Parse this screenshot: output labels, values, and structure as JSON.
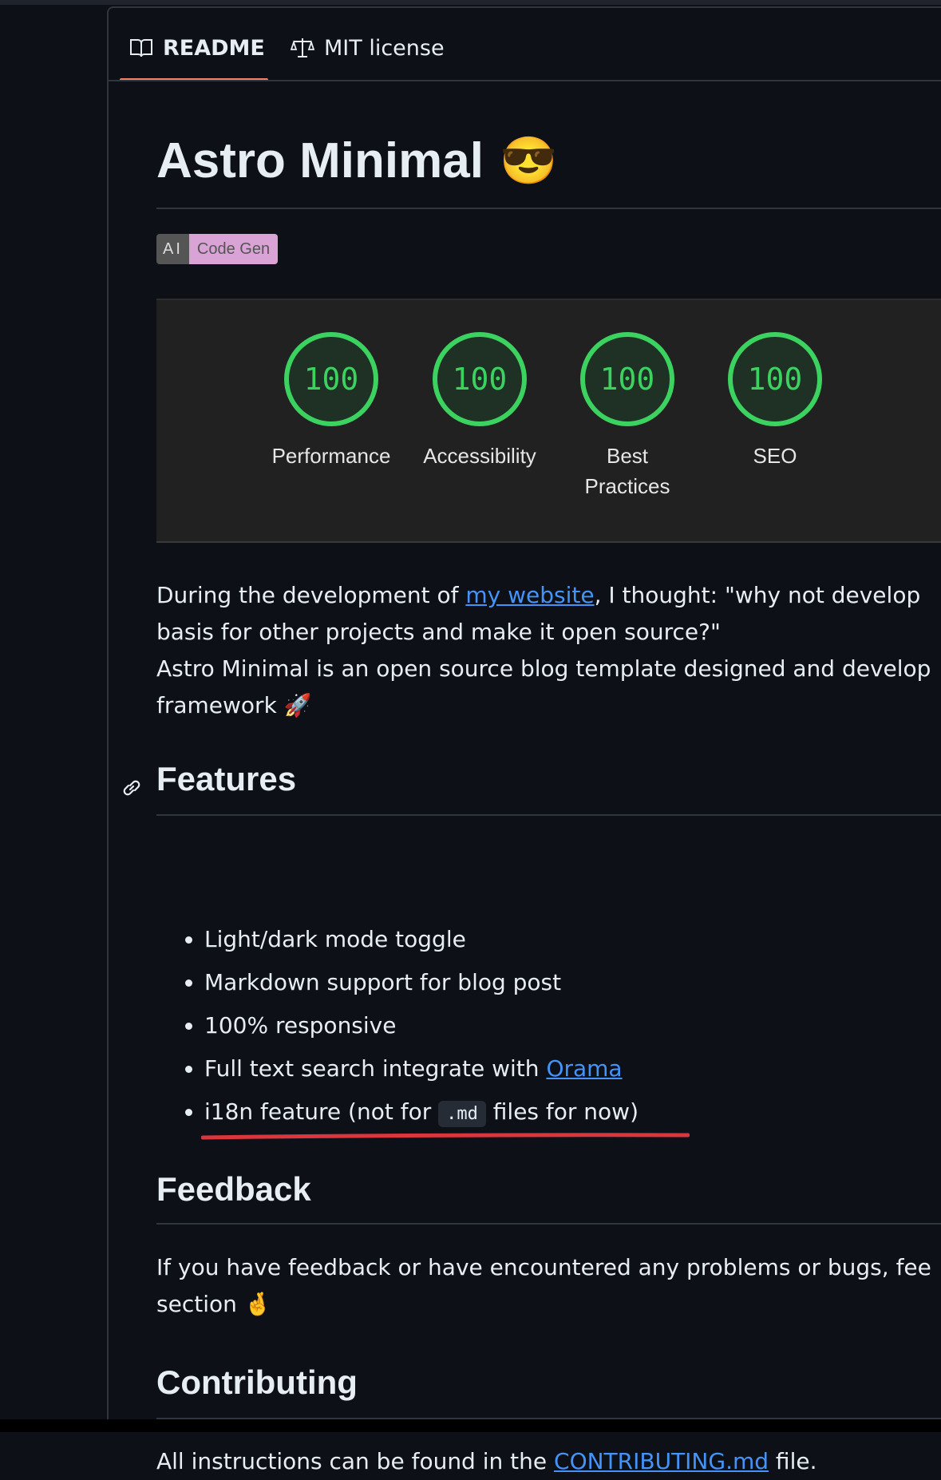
{
  "tabs": {
    "readme": "README",
    "license": "MIT license"
  },
  "title": "Astro Minimal",
  "title_emoji": "😎",
  "badge": {
    "left": "AI",
    "right": "Code Gen"
  },
  "scores": [
    {
      "value": "100",
      "label": "Performance"
    },
    {
      "value": "100",
      "label": "Accessibility"
    },
    {
      "value": "100",
      "label": "Best Practices"
    },
    {
      "value": "100",
      "label": "SEO"
    }
  ],
  "intro": {
    "line1_pre": "During the development of ",
    "line1_link": "my website",
    "line1_post": ", I thought: \"why not develop",
    "line2": "basis for other projects and make it open source?\"",
    "line3": "Astro Minimal is an open source blog template designed and develop",
    "line4": "framework 🚀"
  },
  "features": {
    "heading": "Features",
    "items": [
      "Light/dark mode toggle",
      "Markdown support for blog post",
      "100% responsive"
    ],
    "search_pre": "Full text search integrate with ",
    "search_link": "Orama",
    "i18n_pre": "i18n feature (not for ",
    "i18n_code": ".md",
    "i18n_post": " files for now)"
  },
  "feedback": {
    "heading": "Feedback",
    "line1": "If you have feedback or have encountered any problems or bugs, fee",
    "line2": "section 🤞"
  },
  "contributing": {
    "heading": "Contributing",
    "pre": "All instructions can be found in the ",
    "link": "CONTRIBUTING.md",
    "post": " file."
  },
  "colors": {
    "background": "#0d1117",
    "accent_tab": "#f78166",
    "link": "#4493f8",
    "score_green": "#3bd25f",
    "annotation_red": "#d9363e"
  }
}
